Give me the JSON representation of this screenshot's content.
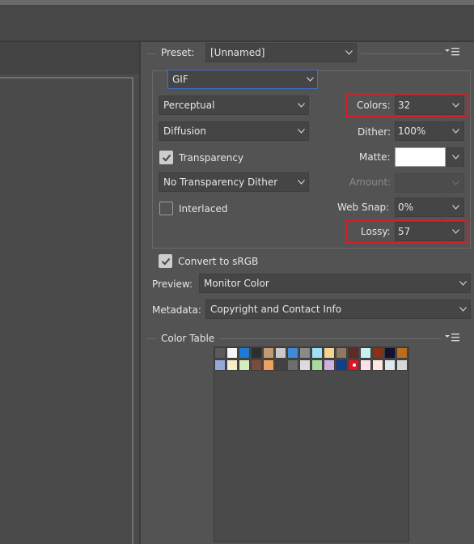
{
  "preset": {
    "label": "Preset:",
    "value": "[Unnamed]"
  },
  "format": {
    "value": "GIF"
  },
  "reduction": {
    "value": "Perceptual"
  },
  "dither_algorithm": {
    "value": "Diffusion"
  },
  "transparency": {
    "label": "Transparency",
    "checked": true
  },
  "transparency_dither": {
    "value": "No Transparency Dither"
  },
  "interlaced": {
    "label": "Interlaced",
    "checked": false
  },
  "colors": {
    "label": "Colors:",
    "value": "32"
  },
  "dither": {
    "label": "Dither:",
    "value": "100%"
  },
  "matte": {
    "label": "Matte:",
    "color": "#ffffff"
  },
  "amount": {
    "label": "Amount:",
    "value": ""
  },
  "web_snap": {
    "label": "Web Snap:",
    "value": "0%"
  },
  "lossy": {
    "label": "Lossy:",
    "value": "57"
  },
  "convert_srgb": {
    "label": "Convert to sRGB",
    "checked": true
  },
  "preview": {
    "label": "Preview:",
    "value": "Monitor Color"
  },
  "metadata": {
    "label": "Metadata:",
    "value": "Copyright and Contact Info"
  },
  "color_table": {
    "title": "Color Table",
    "row1": [
      "#5a5a5a",
      "#f5f5f5",
      "#1f7ad2",
      "#2e2e2e",
      "#c49a72",
      "#c9c9c9",
      "#3f8bd9",
      "#8a8a8a",
      "#9fe0f5",
      "#f2d58f",
      "#8f7963",
      "#5e2a24",
      "#c8f0f0",
      "#8a3210",
      "#13122e",
      "#bb6c1e"
    ],
    "row2": [
      "#95a6dd",
      "#f4efc7",
      "#d4ecbe",
      "#7d4b3d",
      "#efa25e",
      "#424242",
      "#6e6e6e",
      "#dcdcdc",
      "#a8dba0",
      "#d0b2dd",
      "#0e3f8e",
      "#e8131f",
      "#fde0e8",
      "#fde7de",
      "#dce9ee",
      "#d6d6d6"
    ]
  },
  "accent": {
    "highlight": "#d31f25",
    "focus": "#3d6fd1"
  }
}
